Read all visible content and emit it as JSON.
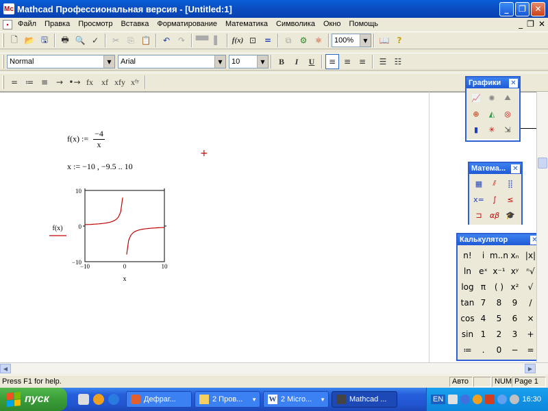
{
  "window": {
    "title": "Mathcad Профессиональная версия - [Untitled:1]",
    "app_icon": "Mc"
  },
  "menu": {
    "items": [
      "Файл",
      "Правка",
      "Просмотр",
      "Вставка",
      "Форматирование",
      "Математика",
      "Символика",
      "Окно",
      "Помощь"
    ]
  },
  "standard_toolbar": {
    "zoom": "100%"
  },
  "format_toolbar": {
    "style": "Normal",
    "font": "Arial",
    "size": "10",
    "bold": "B",
    "italic": "I",
    "underline": "U"
  },
  "math_toolbar": {
    "buttons": [
      "=",
      "≔",
      "≡",
      "→",
      "•→",
      "fx",
      "xf",
      "xfy",
      "xᶠʸ"
    ]
  },
  "worksheet": {
    "definition_lhs": "f(x) :=",
    "definition_num": "−4",
    "definition_den": "x",
    "range_def": "x := −10 , −9.5 .. 10",
    "plot_ylabel": "f(x)",
    "plot_xlabel": "x"
  },
  "chart_data": {
    "type": "line",
    "title": "",
    "xlabel": "x",
    "ylabel": "f(x)",
    "xlim": [
      -10,
      10
    ],
    "ylim": [
      -10,
      10
    ],
    "x_ticks": [
      "−10",
      "0",
      "10"
    ],
    "y_ticks": [
      "10",
      "0",
      "−10"
    ],
    "function": "f(x) = -4/x",
    "series": [
      {
        "color": "#c00000",
        "x": [
          -10,
          -9.5,
          -9,
          -8.5,
          -8,
          -7.5,
          -7,
          -6.5,
          -6,
          -5.5,
          -5,
          -4.5,
          -4,
          -3.5,
          -3,
          -2.5,
          -2,
          -1.5,
          -1,
          -0.5,
          0.5,
          1,
          1.5,
          2,
          2.5,
          3,
          3.5,
          4,
          4.5,
          5,
          5.5,
          6,
          6.5,
          7,
          7.5,
          8,
          8.5,
          9,
          9.5,
          10
        ],
        "y": [
          0.4,
          0.42,
          0.44,
          0.47,
          0.5,
          0.53,
          0.57,
          0.62,
          0.67,
          0.73,
          0.8,
          0.89,
          1,
          1.14,
          1.33,
          1.6,
          2,
          2.67,
          4,
          8,
          -8,
          -4,
          -2.67,
          -2,
          -1.6,
          -1.33,
          -1.14,
          -1,
          -0.89,
          -0.8,
          -0.73,
          -0.67,
          -0.62,
          -0.57,
          -0.53,
          -0.5,
          -0.47,
          -0.44,
          -0.42,
          -0.4
        ]
      }
    ]
  },
  "palettes": {
    "graphs_title": "Графики",
    "math_title": "Матема...",
    "calc_title": "Калькулятор",
    "calc_keys": [
      "n!",
      "i",
      "m..n",
      "xₙ",
      "|x|",
      "ln",
      "eˣ",
      "x⁻¹",
      "xʸ",
      "ⁿ√",
      "log",
      "π",
      "( )",
      "x²",
      "√",
      "tan",
      "7",
      "8",
      "9",
      "/",
      "cos",
      "4",
      "5",
      "6",
      "×",
      "sin",
      "1",
      "2",
      "3",
      "+",
      "≔",
      ".",
      "0",
      "−",
      "="
    ]
  },
  "status": {
    "help": "Press F1 for help.",
    "mode": "Авто",
    "num": "NUM",
    "page": "Page 1"
  },
  "taskbar": {
    "start": "пуск",
    "buttons": [
      "Дефраг...",
      "2 Пров...",
      "2 Micro...",
      "Mathcad ..."
    ],
    "lang": "EN",
    "clock": "16:30"
  }
}
